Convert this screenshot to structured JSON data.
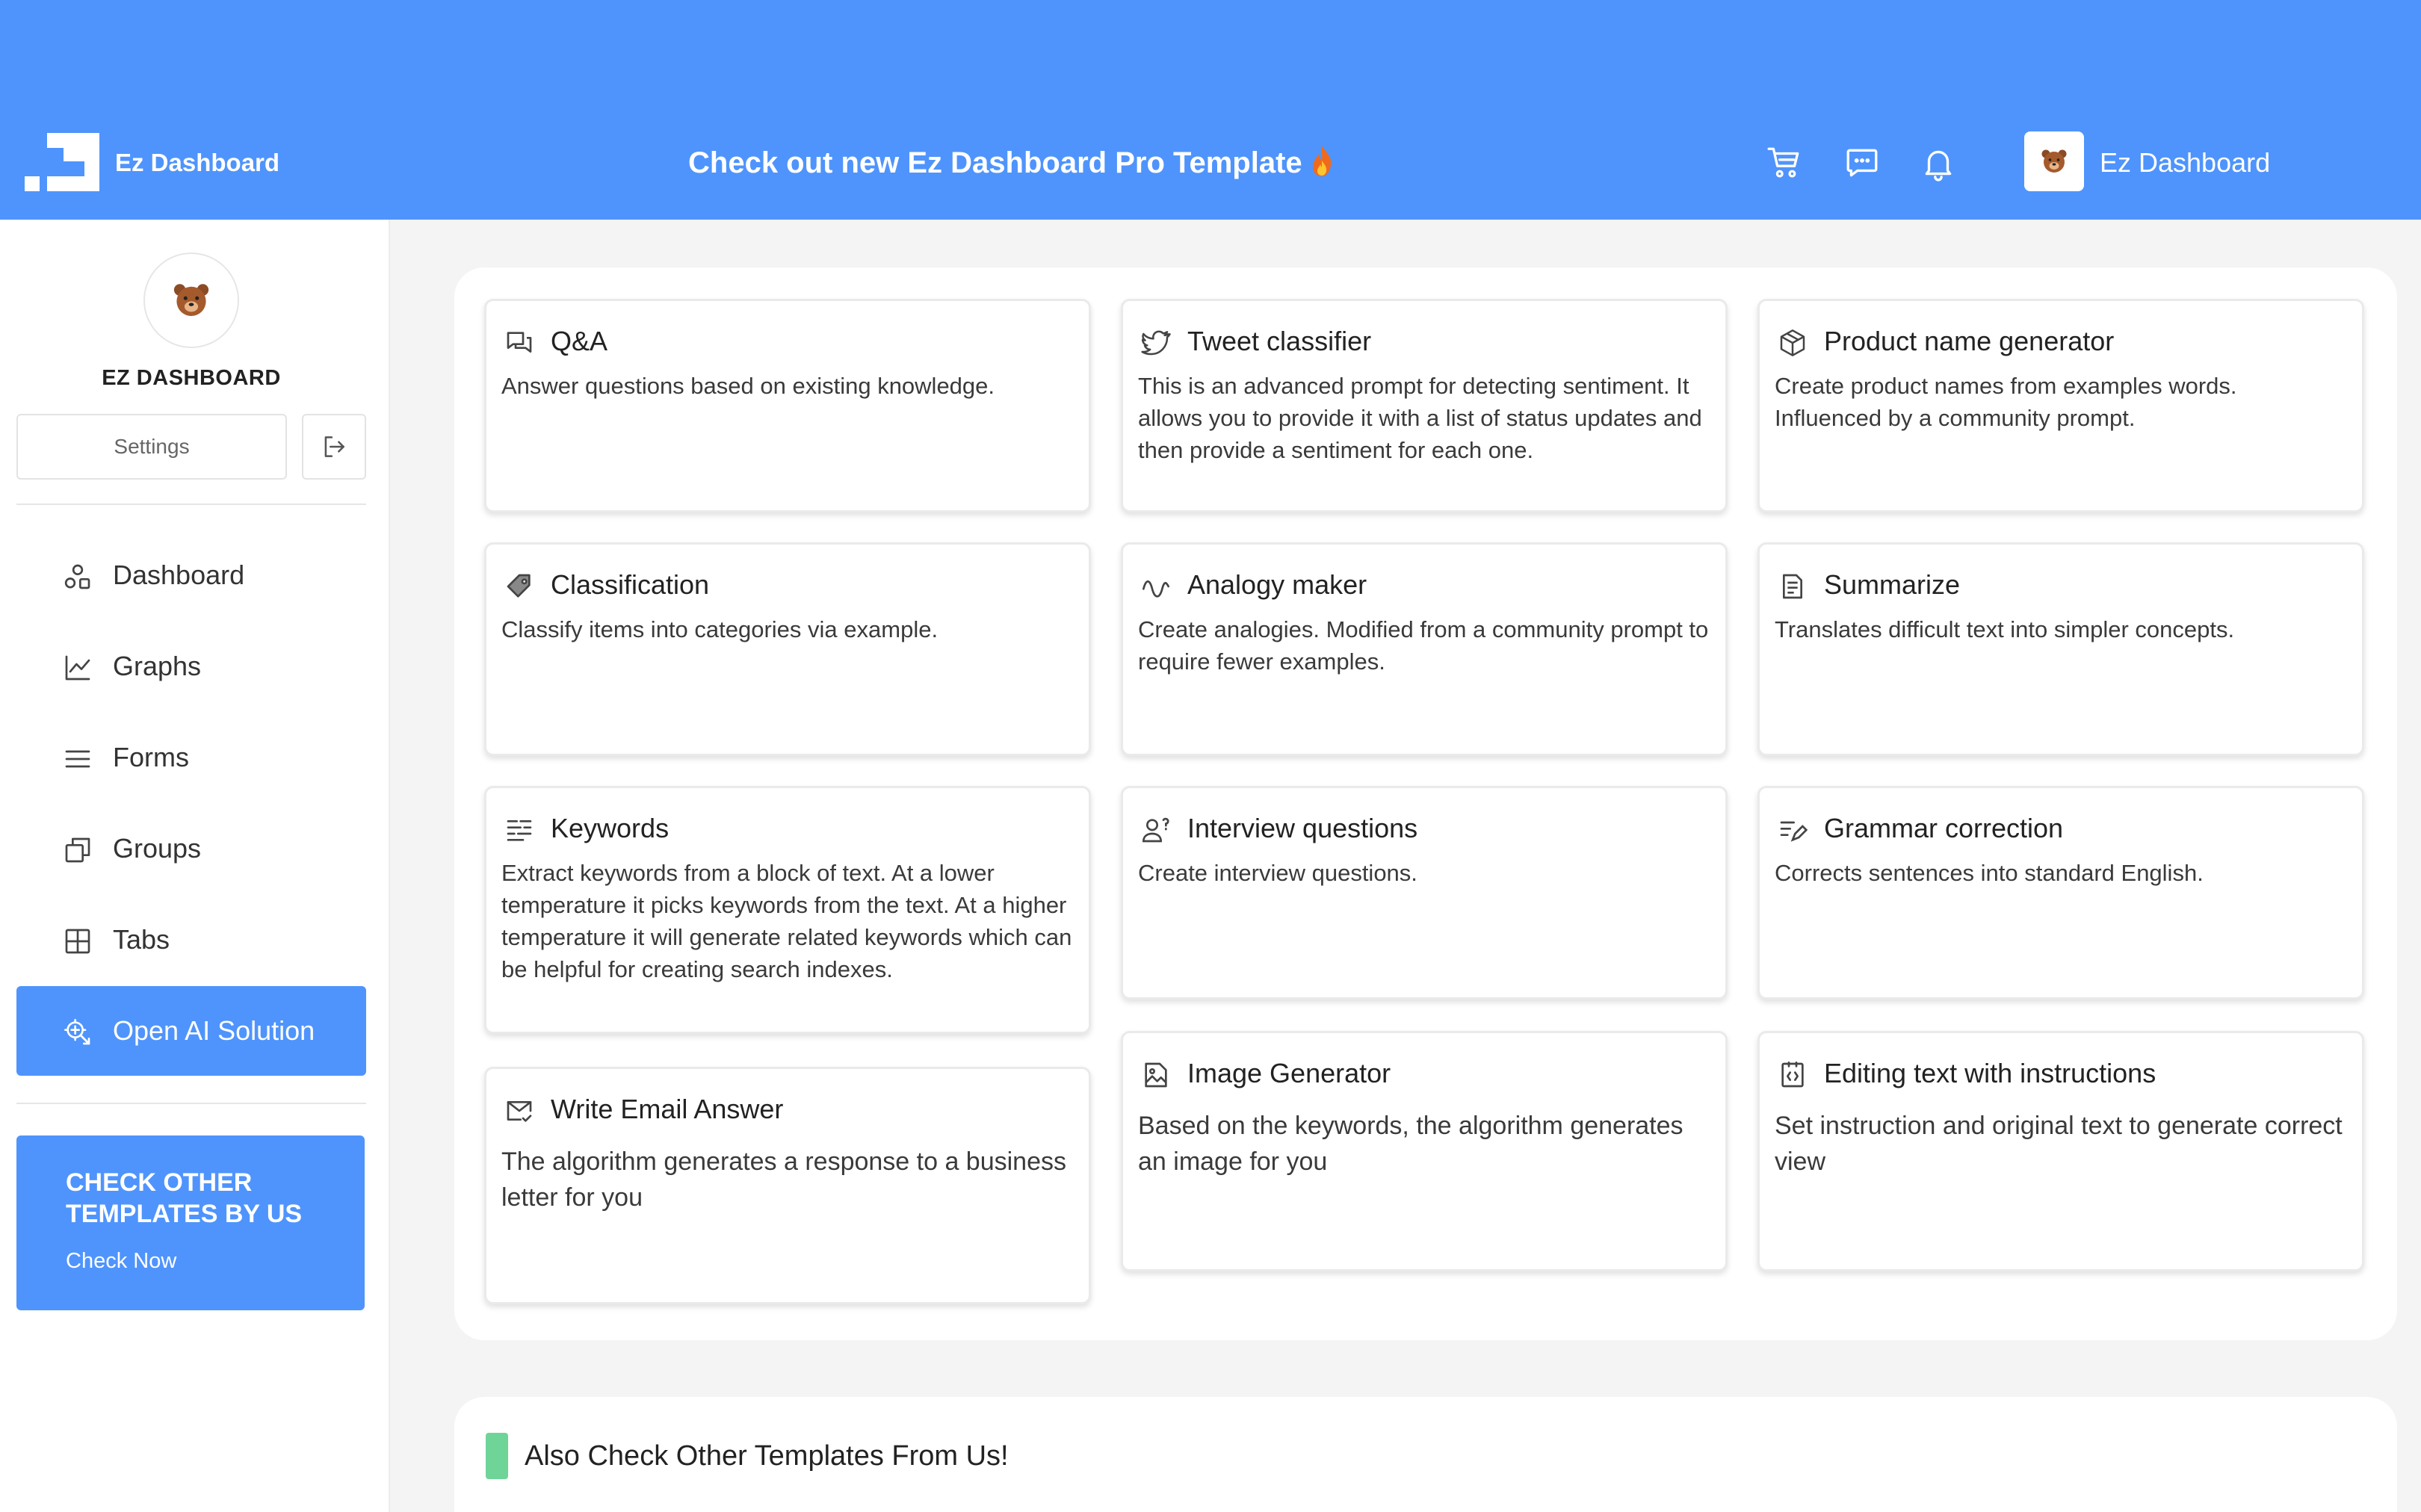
{
  "colors": {
    "accent": "#4f94fc",
    "panel": "#ffffff",
    "background": "#f4f4f5",
    "green_marker": "#6ed498"
  },
  "header": {
    "brand": "Ez Dashboard",
    "promo_text": "Check out new Ez Dashboard Pro Template",
    "promo_emoji_icon": "fire-icon",
    "icons": [
      "cart-icon",
      "chat-icon",
      "bell-icon"
    ],
    "user_name": "Ez Dashboard",
    "user_avatar_icon": "bear-icon"
  },
  "sidebar": {
    "profile_name": "EZ DASHBOARD",
    "settings_label": "Settings",
    "logout_icon": "logout-icon",
    "items": [
      {
        "label": "Dashboard",
        "icon": "shapes-icon"
      },
      {
        "label": "Graphs",
        "icon": "chart-line-icon"
      },
      {
        "label": "Forms",
        "icon": "list-icon"
      },
      {
        "label": "Groups",
        "icon": "copy-icon"
      },
      {
        "label": "Tabs",
        "icon": "grid-icon"
      },
      {
        "label": "Open AI Solution",
        "icon": "ai-icon",
        "active": true
      }
    ],
    "promo": {
      "title": "CHECK OTHER TEMPLATES BY US",
      "link": "Check Now"
    }
  },
  "cards": [
    {
      "title": "Q&A",
      "icon": "qa-icon",
      "desc": "Answer questions based on existing knowledge."
    },
    {
      "title": "Tweet classifier",
      "icon": "twitter-icon",
      "desc": "This is an advanced prompt for detecting sentiment. It allows you to provide it with a list of status updates and then provide a sentiment for each one."
    },
    {
      "title": "Product name generator",
      "icon": "box-icon",
      "desc": "Create product names from examples words. Influenced by a community prompt."
    },
    {
      "title": "Classification",
      "icon": "tag-icon",
      "desc": "Classify items into categories via example."
    },
    {
      "title": "Analogy maker",
      "icon": "wave-icon",
      "desc": "Create analogies. Modified from a community prompt to require fewer examples."
    },
    {
      "title": "Summarize",
      "icon": "document-icon",
      "desc": "Translates difficult text into simpler concepts."
    },
    {
      "title": "Keywords",
      "icon": "keywords-icon",
      "desc": "Extract keywords from a block of text. At a lower temperature it picks keywords from the text. At a higher temperature it will generate related keywords which can be helpful for creating search indexes."
    },
    {
      "title": "Interview questions",
      "icon": "person-question-icon",
      "desc": "Create interview questions."
    },
    {
      "title": "Grammar correction",
      "icon": "text-edit-icon",
      "desc": "Corrects sentences into standard English."
    },
    {
      "title": "Write Email Answer",
      "icon": "mail-check-icon",
      "desc": "The algorithm generates a response to a business letter for you"
    },
    {
      "title": "Image Generator",
      "icon": "image-icon",
      "desc": "Based on the keywords, the algorithm generates an image for you"
    },
    {
      "title": "Editing text with instructions",
      "icon": "code-file-icon",
      "desc": "Set instruction and original text to generate correct view"
    }
  ],
  "bottom": {
    "title": "Also Check Other Templates From Us!"
  }
}
